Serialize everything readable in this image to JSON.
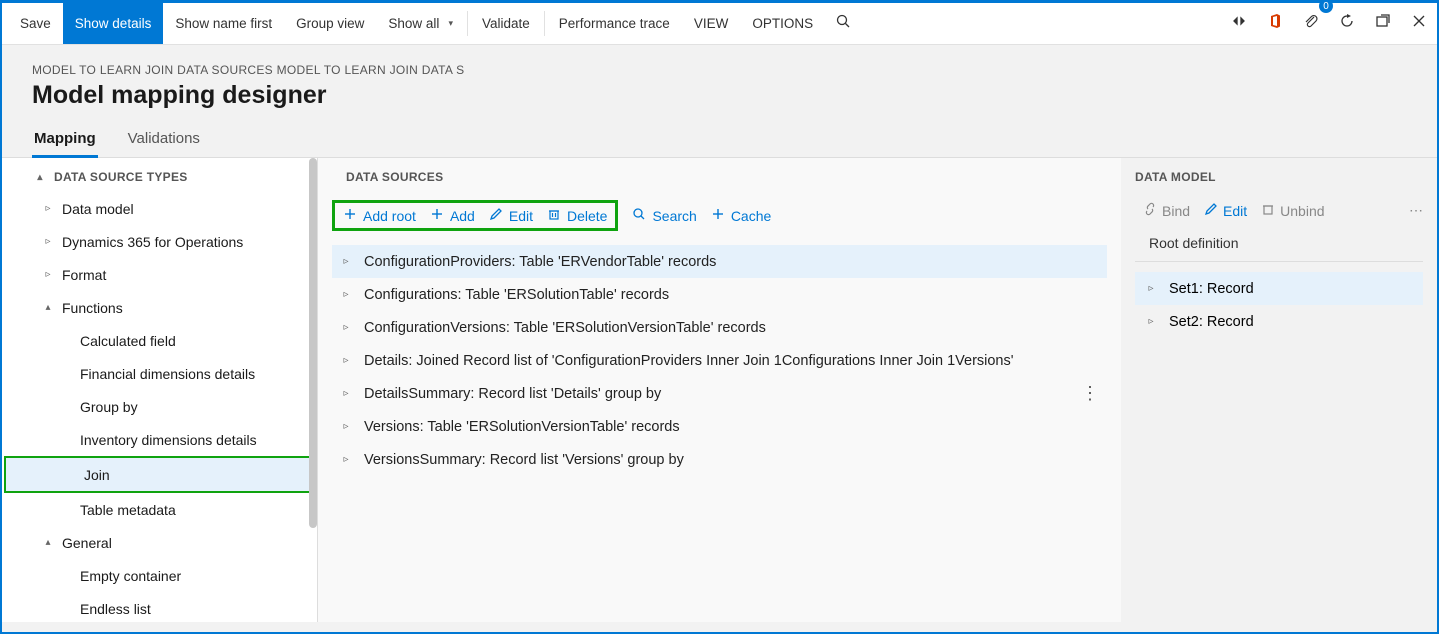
{
  "toolbar": {
    "save_label": "Save",
    "show_details_label": "Show details",
    "show_name_first_label": "Show name first",
    "group_view_label": "Group view",
    "show_all_label": "Show all",
    "validate_label": "Validate",
    "performance_trace_label": "Performance trace",
    "view_label": "VIEW",
    "options_label": "OPTIONS",
    "badge_count": "0"
  },
  "header": {
    "breadcrumb": "MODEL TO LEARN JOIN DATA SOURCES MODEL TO LEARN JOIN DATA S",
    "title": "Model mapping designer"
  },
  "tabs": {
    "mapping": "Mapping",
    "validations": "Validations"
  },
  "left": {
    "panel_title": "DATA SOURCE TYPES",
    "items": {
      "data_model": "Data model",
      "d365": "Dynamics 365 for Operations",
      "format": "Format",
      "functions": "Functions",
      "calculated_field": "Calculated field",
      "financial_dimensions": "Financial dimensions details",
      "group_by": "Group by",
      "inventory_dimensions": "Inventory dimensions details",
      "join": "Join",
      "table_metadata": "Table metadata",
      "general": "General",
      "empty_container": "Empty container",
      "endless_list": "Endless list"
    }
  },
  "mid": {
    "panel_title": "DATA SOURCES",
    "btn_add_root": "Add root",
    "btn_add": "Add",
    "btn_edit": "Edit",
    "btn_delete": "Delete",
    "btn_search": "Search",
    "btn_cache": "Cache",
    "rows": {
      "r0": "ConfigurationProviders: Table 'ERVendorTable' records",
      "r1": "Configurations: Table 'ERSolutionTable' records",
      "r2": "ConfigurationVersions: Table 'ERSolutionVersionTable' records",
      "r3": "Details: Joined Record list of 'ConfigurationProviders Inner Join 1Configurations Inner Join 1Versions'",
      "r4": "DetailsSummary: Record list 'Details' group by",
      "r5": "Versions: Table 'ERSolutionVersionTable' records",
      "r6": "VersionsSummary: Record list 'Versions' group by"
    }
  },
  "right": {
    "panel_title": "DATA MODEL",
    "btn_bind": "Bind",
    "btn_edit": "Edit",
    "btn_unbind": "Unbind",
    "root_definition_label": "Root definition",
    "rows": {
      "set1": "Set1: Record",
      "set2": "Set2: Record"
    }
  }
}
